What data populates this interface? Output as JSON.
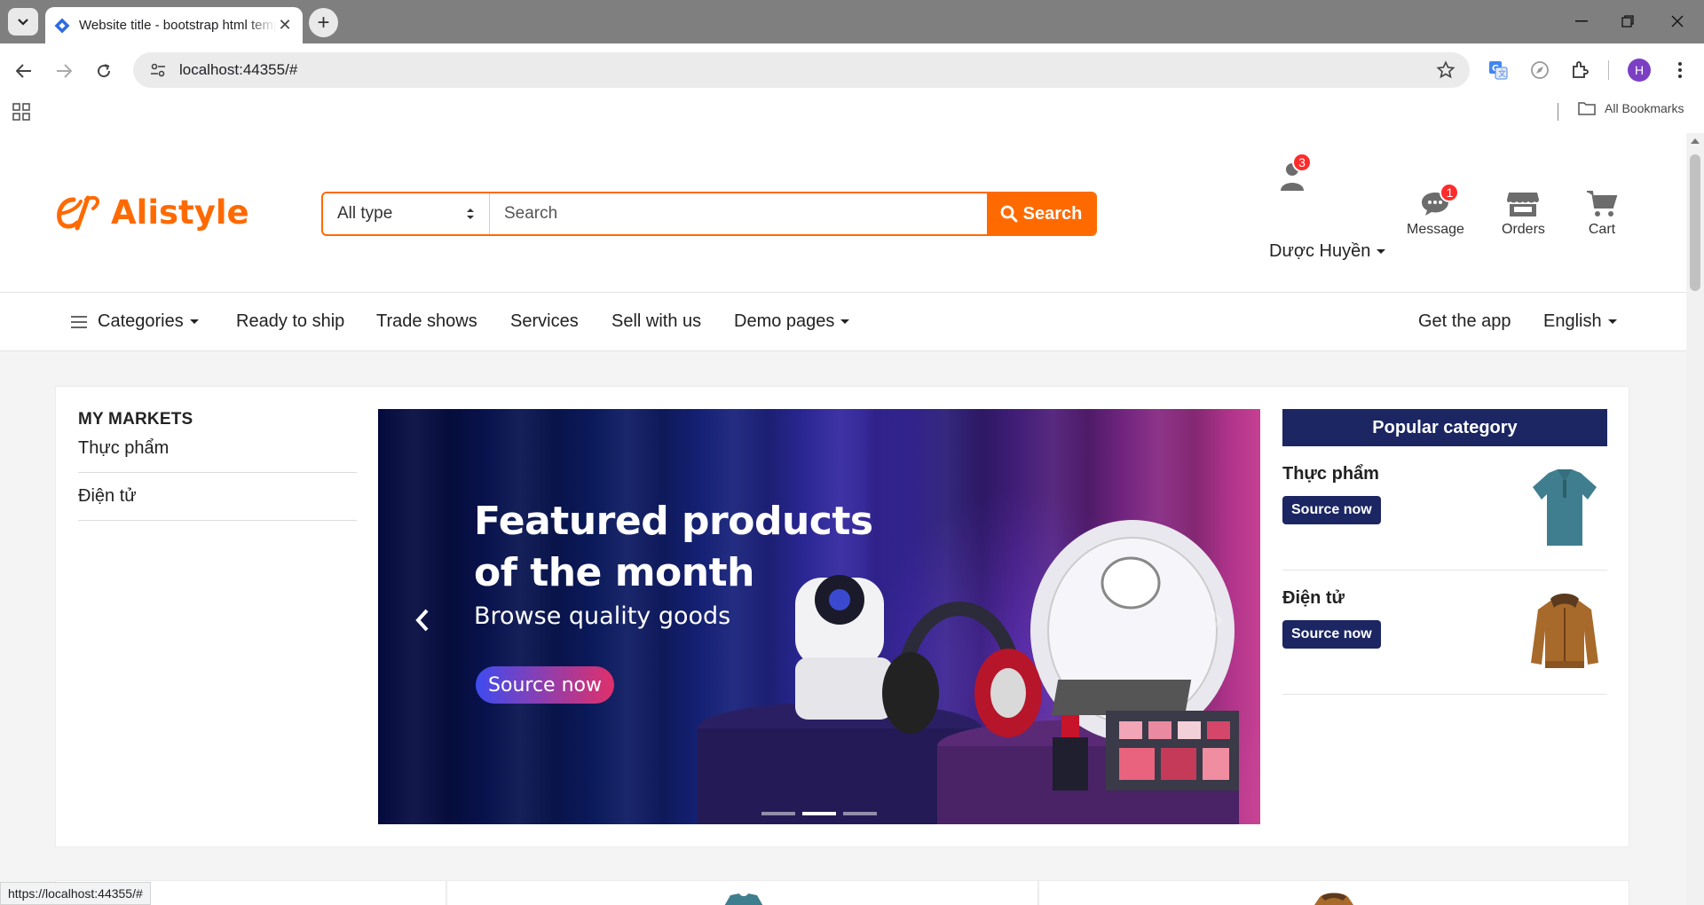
{
  "browser": {
    "tab_title": "Website title - bootstrap html template",
    "url": "localhost:44355/#",
    "profile_initial": "H",
    "bookmarks_label": "All Bookmarks",
    "status_url": "https://localhost:44355/#"
  },
  "header": {
    "logo_text": "Alistyle",
    "search": {
      "type_selected": "All type",
      "placeholder": "Search",
      "button_label": "Search"
    },
    "user": {
      "name": "Dược Huyền",
      "badge_count": "3"
    },
    "actions": [
      {
        "label": "Message",
        "badge": "1"
      },
      {
        "label": "Orders"
      },
      {
        "label": "Cart"
      }
    ]
  },
  "nav": {
    "categories": "Categories",
    "links": [
      "Ready to ship",
      "Trade shows",
      "Services",
      "Sell with us"
    ],
    "demo_pages": "Demo pages",
    "get_app": "Get the app",
    "language": "English"
  },
  "markets": {
    "title": "MY MARKETS",
    "items": [
      "Thực phẩm",
      "Điện tử"
    ]
  },
  "banner": {
    "title_line1": "Featured products",
    "title_line2": "of the month",
    "subtitle": "Browse quality goods",
    "cta": "Source now",
    "active_slide": 2,
    "slide_count": 3
  },
  "popular": {
    "title": "Popular category",
    "items": [
      {
        "title": "Thực phẩm",
        "button": "Source now",
        "image": "polo-shirt"
      },
      {
        "title": "Điện tử",
        "button": "Source now",
        "image": "jacket"
      }
    ]
  },
  "colors": {
    "accent": "#ff6a00",
    "navy": "#1b2662",
    "badge": "#ff2b2b"
  }
}
